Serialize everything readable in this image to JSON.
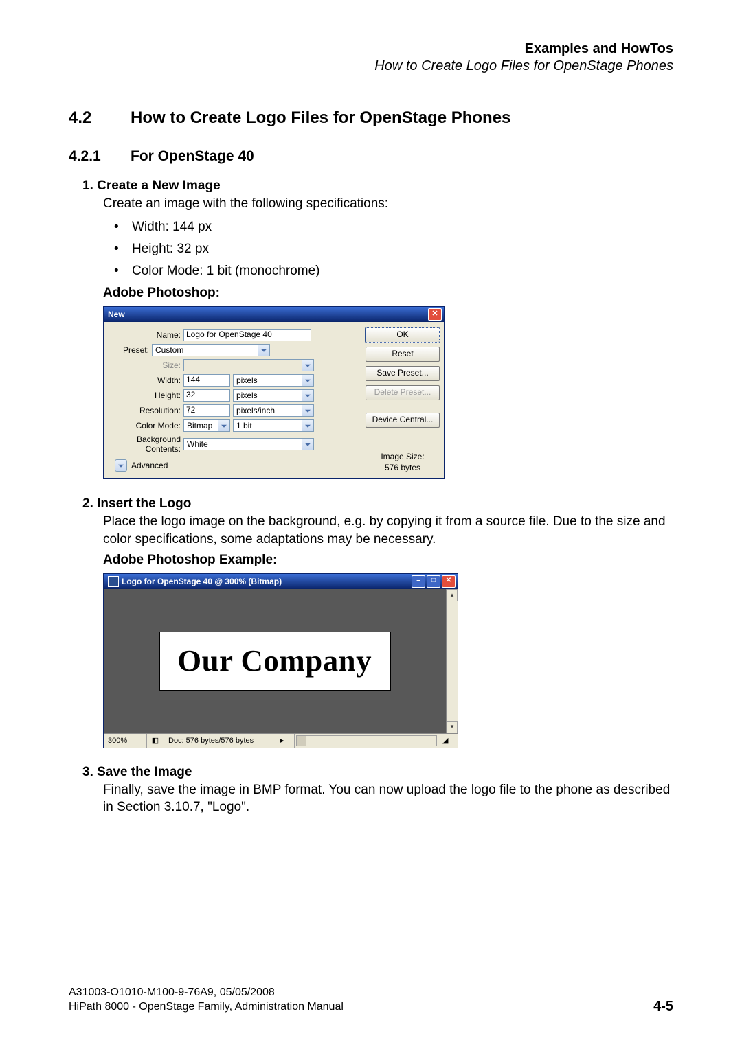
{
  "header": {
    "title": "Examples and HowTos",
    "subtitle": "How to Create Logo Files for OpenStage Phones"
  },
  "section": {
    "num": "4.2",
    "title": "How to Create Logo Files for OpenStage Phones"
  },
  "subsection": {
    "num": "4.2.1",
    "title": "For OpenStage 40"
  },
  "step1": {
    "label": "1.  Create a New Image",
    "intro": "Create an image with the following specifications:",
    "bullets": [
      "Width: 144 px",
      "Height: 32 px",
      "Color Mode: 1 bit (monochrome)"
    ],
    "sublabel": "Adobe Photoshop:"
  },
  "psNew": {
    "title": "New",
    "labels": {
      "name": "Name:",
      "preset": "Preset:",
      "size": "Size:",
      "width": "Width:",
      "height": "Height:",
      "resolution": "Resolution:",
      "colorMode": "Color Mode:",
      "bgContents": "Background Contents:",
      "advanced": "Advanced"
    },
    "values": {
      "name": "Logo for OpenStage 40",
      "preset": "Custom",
      "size": "",
      "width": "144",
      "widthUnit": "pixels",
      "height": "32",
      "heightUnit": "pixels",
      "resolution": "72",
      "resolutionUnit": "pixels/inch",
      "colorMode": "Bitmap",
      "colorDepth": "1 bit",
      "bgContents": "White"
    },
    "buttons": {
      "ok": "OK",
      "reset": "Reset",
      "savePreset": "Save Preset...",
      "deletePreset": "Delete Preset...",
      "deviceCentral": "Device Central..."
    },
    "info": {
      "sizeLabel": "Image Size:",
      "sizeValue": "576 bytes"
    }
  },
  "step2": {
    "label": "2.  Insert the Logo",
    "body": "Place the logo image on the background, e.g. by copying it from a source file. Due to the size and color specifications, some adaptations may be necessary.",
    "sublabel": "Adobe Photoshop Example:"
  },
  "psCanvas": {
    "title": "Logo for OpenStage 40 @ 300% (Bitmap)",
    "logoText": "Our Company",
    "status": {
      "zoom": "300%",
      "doc": "Doc: 576 bytes/576 bytes"
    }
  },
  "step3": {
    "label": "3.  Save the Image",
    "body": "Finally, save the image in BMP format. You can now upload the logo file to the phone as described in Section 3.10.7, \"Logo\"."
  },
  "footer": {
    "line1": "A31003-O1010-M100-9-76A9, 05/05/2008",
    "line2": "HiPath 8000 - OpenStage Family, Administration Manual",
    "pageNum": "4-5"
  }
}
